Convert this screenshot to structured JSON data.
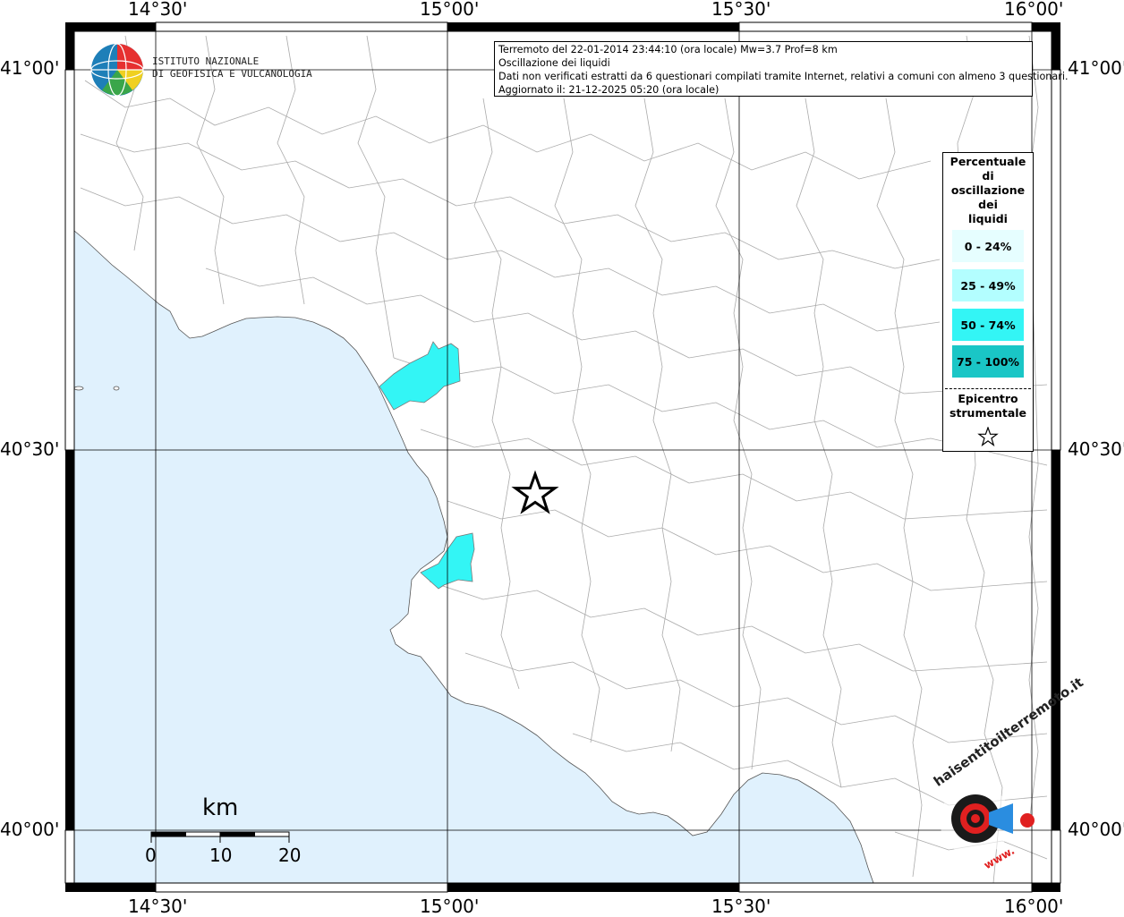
{
  "map": {
    "lon_labels": [
      "14°30'",
      "15°00'",
      "15°30'",
      "16°00'"
    ],
    "lat_labels": [
      "41°00'",
      "40°30'",
      "40°00'"
    ],
    "colors": {
      "sea": "#e0f1fd",
      "land": "#ffffff",
      "boundary": "#999999",
      "grid": "#000000",
      "affected": "#33f5f5"
    }
  },
  "logo": {
    "line1": "ISTITUTO NAZIONALE",
    "line2": "DI GEOFISICA E VULCANOLOGIA"
  },
  "info": {
    "line1": "Terremoto del 22-01-2014 23:44:10 (ora locale) Mw=3.7 Prof=8 km",
    "line2": "Oscillazione dei liquidi",
    "line3": "Dati non verificati estratti da 6 questionari compilati tramite Internet, relativi a comuni con almeno 3 questionari.",
    "line4": "Aggiornato il: 21-12-2025 05:20 (ora locale)"
  },
  "legend": {
    "title_lines": [
      "Percentuale",
      "di",
      "oscillazione",
      "dei",
      "liquidi"
    ],
    "items": [
      {
        "label": "0 - 24%",
        "color": "#e6feff"
      },
      {
        "label": "25 - 49%",
        "color": "#b3feff"
      },
      {
        "label": "50 - 74%",
        "color": "#33f5f5"
      },
      {
        "label": "75 - 100%",
        "color": "#1ac6c6"
      }
    ],
    "epicenter_lines": [
      "Epicentro",
      "strumentale"
    ],
    "epicenter_icon": "star-icon"
  },
  "scale_bar": {
    "unit": "km",
    "labels": [
      "0",
      "10",
      "20"
    ]
  },
  "hsit_logo": {
    "text": "haisentitoilterremoto.it",
    "www": "www."
  }
}
